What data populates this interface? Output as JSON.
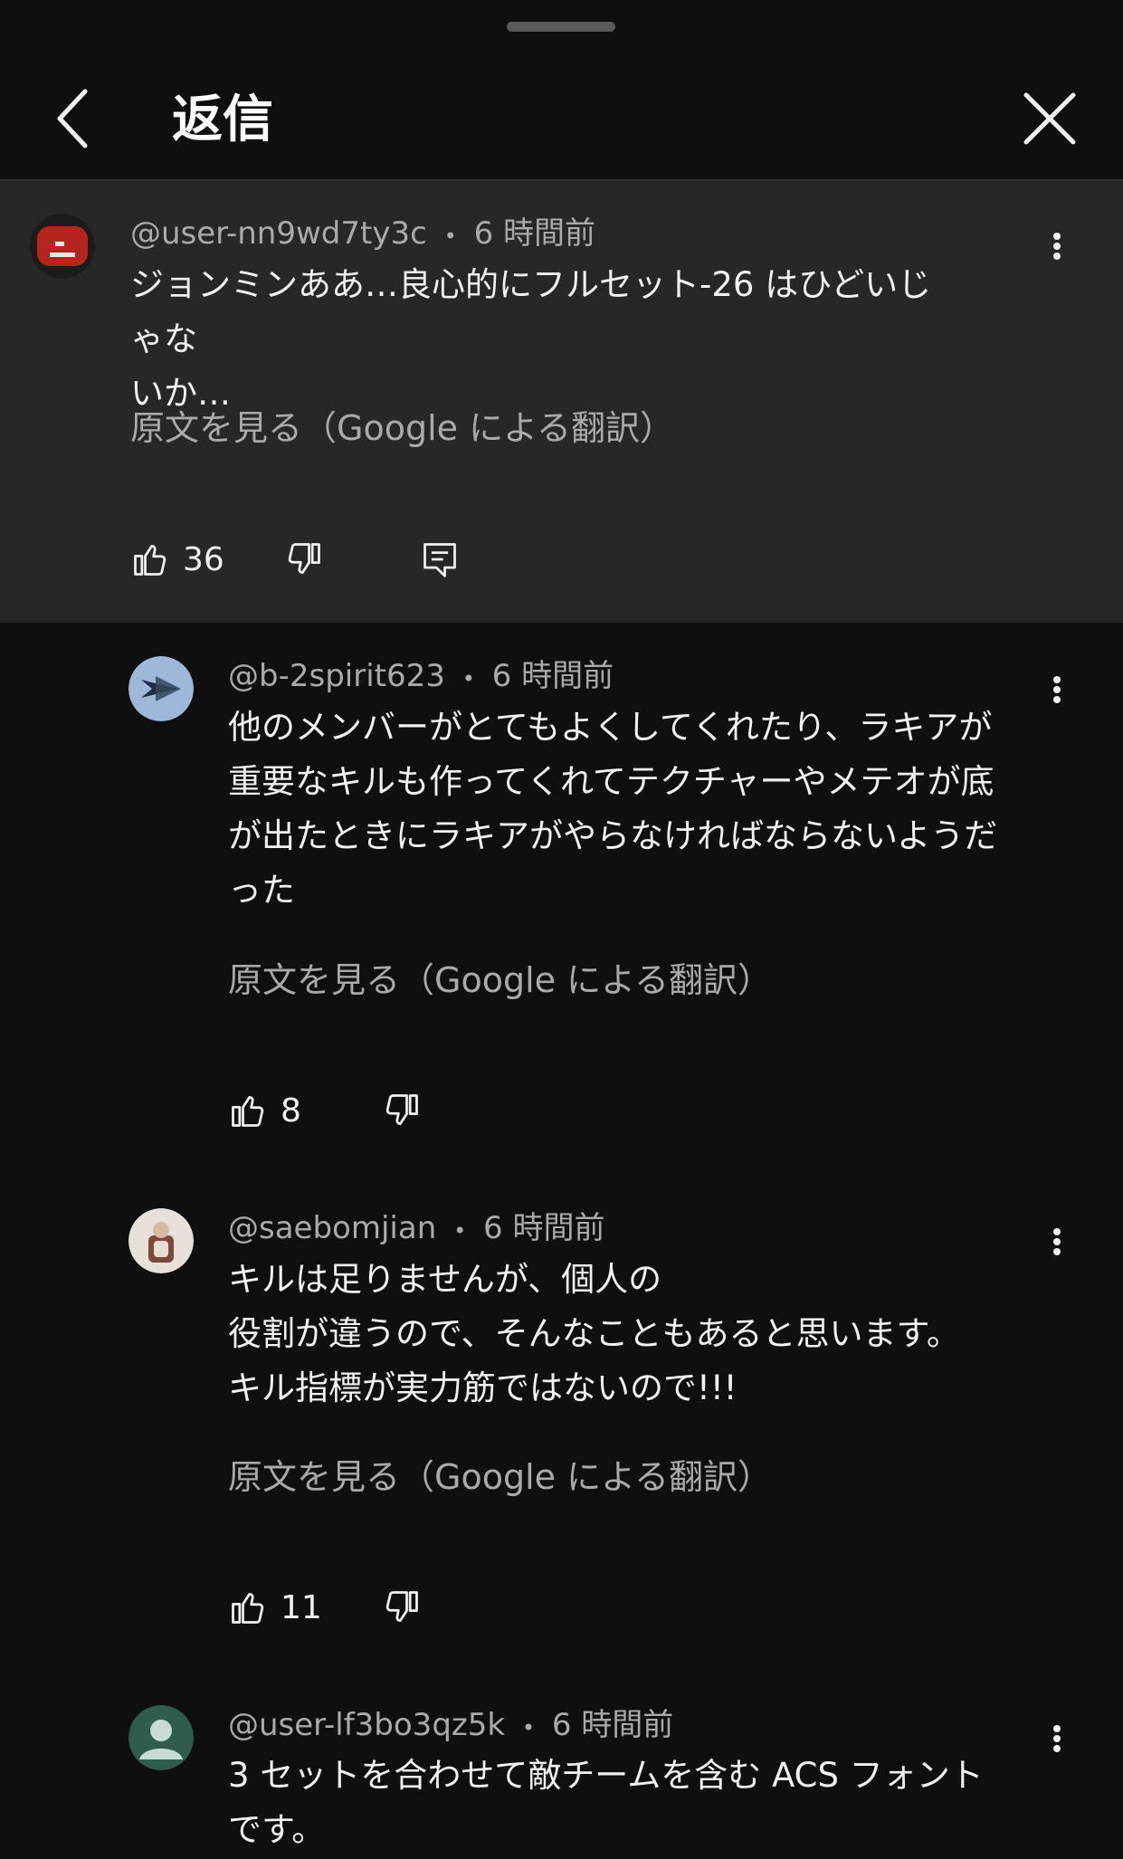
{
  "header": {
    "title": "返信"
  },
  "comments": [
    {
      "author": "@user-nn9wd7ty3c",
      "sep": "•",
      "time": "6 時間前",
      "lines": [
        "ジョンミンああ…良心的にフルセット-26 はひどいじゃな",
        "いか…"
      ],
      "translate": "原文を見る（Google による翻訳）",
      "likes": "36",
      "avatar_color": "#b5251e"
    },
    {
      "author": "@b-2spirit623",
      "sep": "•",
      "time": "6 時間前",
      "lines": [
        "他のメンバーがとてもよくしてくれたり、ラキアが",
        "重要なキルも作ってくれてテクチャーやメテオが底",
        "が出たときにラキアがやらなければならないようだ",
        "った"
      ],
      "translate": "原文を見る（Google による翻訳）",
      "likes": "8",
      "avatar_color": "#9fb7d8"
    },
    {
      "author": "@saebomjian",
      "sep": "•",
      "time": "6 時間前",
      "lines": [
        "キルは足りませんが、個人の",
        "役割が違うので、そんなこともあると思います。",
        "キル指標が実力筋ではないので!!!"
      ],
      "translate": "原文を見る（Google による翻訳）",
      "likes": "11",
      "avatar_color": "#e7e1da"
    },
    {
      "author": "@user-lf3bo3qz5k",
      "sep": "•",
      "time": "6 時間前",
      "lines": [
        "3 セットを合わせて敵チームを含む ACS フォント",
        "です。"
      ],
      "avatar_color": "#2f5c4c"
    }
  ],
  "colors": {
    "background": "#0f0f0f",
    "parent_bg": "#272727",
    "secondary_text": "#aaaaaa"
  },
  "icons": [
    "back-arrow-icon",
    "close-icon",
    "more-vert-icon",
    "thumb-up-icon",
    "thumb-down-icon",
    "reply-icon"
  ]
}
